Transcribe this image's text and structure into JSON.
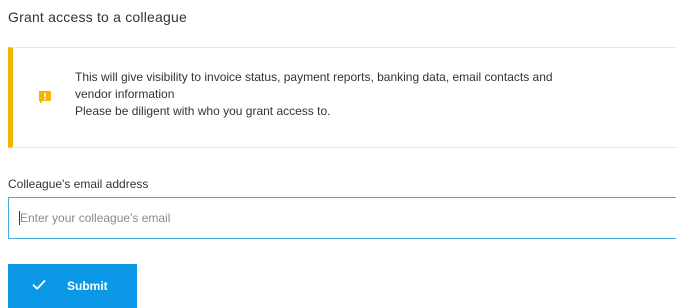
{
  "title": "Grant access to a colleague",
  "warning": {
    "icon": "warning-speech-icon",
    "accent_color": "#f5b400",
    "lines": [
      "This will give visibility to invoice status, payment reports, banking data, email contacts and",
      "vendor information",
      "Please be diligent with who you grant access to."
    ]
  },
  "email_field": {
    "label": "Colleague's email address",
    "value": "",
    "placeholder": "Enter your colleague's email",
    "focus_color": "#4aa8e0"
  },
  "submit": {
    "label": "Submit",
    "icon": "check-icon",
    "color": "#0a97e6"
  }
}
